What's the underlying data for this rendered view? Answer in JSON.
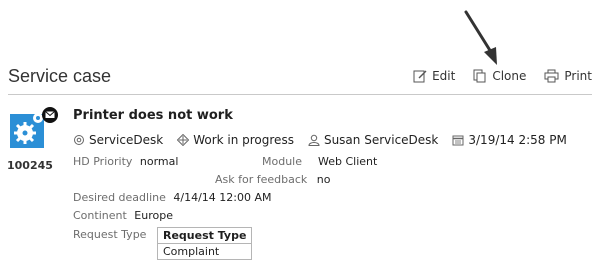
{
  "header": {
    "title": "Service case",
    "actions": {
      "edit": "Edit",
      "clone": "Clone",
      "print": "Print"
    }
  },
  "case": {
    "id": "100245",
    "title": "Printer does not work",
    "meta": {
      "desk": "ServiceDesk",
      "status": "Work in progress",
      "person": "Susan ServiceDesk",
      "datetime": "3/19/14 2:58 PM"
    },
    "fields": {
      "hd_priority_label": "HD Priority",
      "hd_priority_value": "normal",
      "module_label": "Module",
      "module_value": "Web Client",
      "ask_feedback_label": "Ask for feedback",
      "ask_feedback_value": "no",
      "deadline_label": "Desired deadline",
      "deadline_value": "4/14/14 12:00 AM",
      "continent_label": "Continent",
      "continent_value": "Europe",
      "request_type_label": "Request Type"
    },
    "request_table": {
      "header": "Request Type",
      "rows": [
        "Complaint"
      ]
    }
  },
  "colors": {
    "accent_icon": "#2b8fd6",
    "divider": "#c9c9c9"
  }
}
